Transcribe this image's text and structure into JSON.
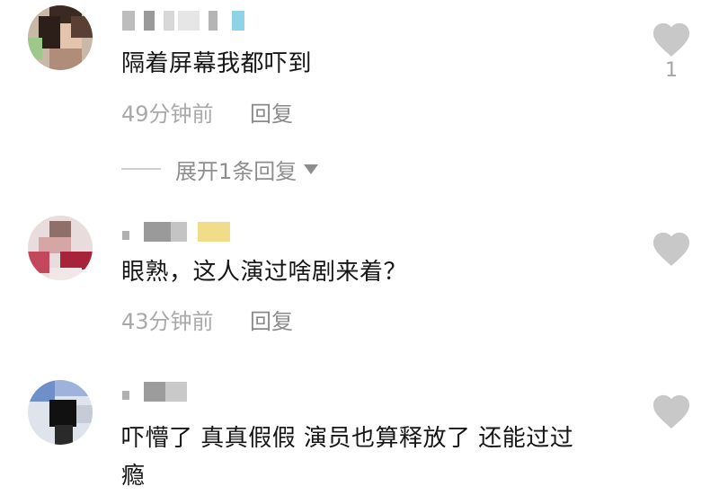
{
  "comments": [
    {
      "text": "隔着屏幕我都吓到",
      "time": "49分钟前",
      "reply_label": "回复",
      "likes": "1",
      "expand_label": "展开1条回复"
    },
    {
      "text": "眼熟，这人演过啥剧来着？",
      "time": "43分钟前",
      "reply_label": "回复"
    },
    {
      "text_line1": "吓懵了 真真假假 演员也算释放了 还能过过",
      "text_line2": "瘾"
    }
  ],
  "icons": {
    "like": "heart-icon",
    "expand": "caret-down-icon"
  },
  "colors": {
    "text": "#161616",
    "meta": "#a9a9a9",
    "heart": "#c8c8c8"
  }
}
